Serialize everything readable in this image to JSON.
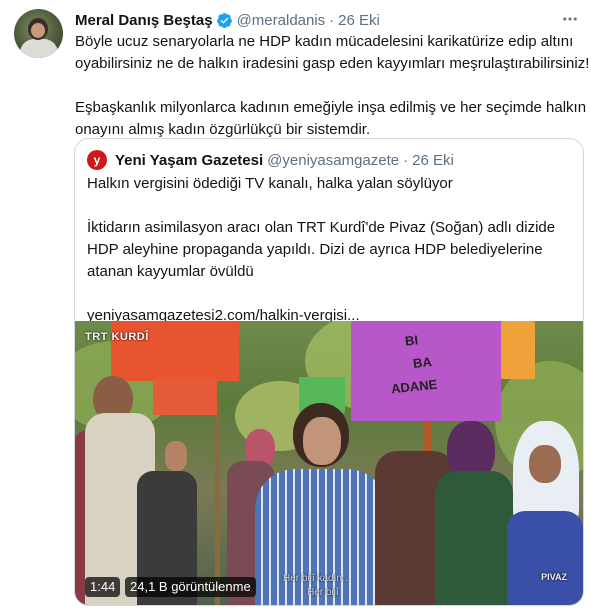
{
  "tweet": {
    "author_name": "Meral Danış Beştaş",
    "author_handle": "@meraldanis",
    "separator": "·",
    "date": "26 Eki",
    "more_icon": "more-icon",
    "verified_icon": "verified-badge-icon",
    "accent_color": "#1da1f2",
    "text_lines": [
      "Böyle ucuz senaryolarla ne HDP kadın mücadelesini karikatürize edip altını",
      "oyabilirsiniz ne de halkın iradesini gasp eden kayyımları meşrulaştırabilirsiniz!",
      "Eşbaşkanlık milyonlarca kadının emeğiyle inşa edilmiş ve her seçimde halkın",
      "onayını almış kadın özgürlükçü bir sistemdir."
    ]
  },
  "quote": {
    "logo_letter": "y",
    "source_name": "Yeni Yaşam Gazetesi",
    "source_handle": "@yeniyasamgazete",
    "separator": "·",
    "date": "26 Eki",
    "headline": "Halkın vergisini ödediği TV kanalı, halka yalan söylüyor",
    "body_lines": [
      "İktidarın asimilasyon aracı olan TRT Kurdî'de Pivaz (Soğan) adlı dizide",
      "HDP aleyhine propaganda yapıldı. Dizi de ayrıca HDP belediyelerine",
      "atanan kayyumlar övüldü"
    ],
    "link": "yeniyasamgazetesi2.com/halkin-vergisi..."
  },
  "video": {
    "channel_logo": "TRT KURDÎ",
    "show_title": "PIVAZ",
    "subtitle_lines": [
      "Her bijî kadın...",
      "Her bijî"
    ],
    "sign_text": [
      "BI",
      "BA",
      "ADANE"
    ],
    "duration": "1:44",
    "views": "24,1 B görüntülenme"
  }
}
